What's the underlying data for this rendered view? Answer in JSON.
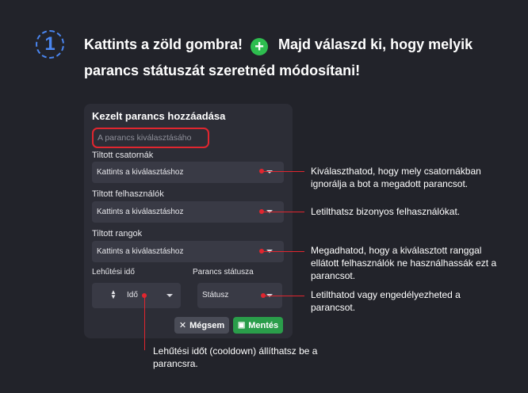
{
  "step": {
    "number": "1"
  },
  "heading": {
    "part1": "Kattints a zöld gombra!",
    "plus_icon": "+",
    "part2": "Majd válaszd ki, hogy melyik parancs státuszát szeretnéd módosítani!"
  },
  "panel": {
    "title": "Kezelt parancs hozzáadása",
    "search_placeholder": "A parancs kiválasztásáho",
    "channels": {
      "label": "Tiltott csatornák",
      "value": "Kattints a kiválasztáshoz"
    },
    "users": {
      "label": "Tiltott felhasználók",
      "value": "Kattints a kiválasztáshoz"
    },
    "roles": {
      "label": "Tiltott rangok",
      "value": "Kattints a kiválasztáshoz"
    },
    "cooldown": {
      "label": "Lehűtési idő",
      "unit": "Idő"
    },
    "status": {
      "label": "Parancs státusza",
      "value": "Státusz"
    },
    "cancel_button": "Mégsem",
    "save_button": "Mentés"
  },
  "annotations": {
    "channels": "Kiválaszthatod, hogy mely csatornákban ignorálja a bot a megadott parancsot.",
    "users": "Letilthatsz bizonyos felhasználókat.",
    "roles": "Megadhatod, hogy a kiválasztott ranggal ellátott felhasználók ne használhassák ezt a parancsot.",
    "status": "Letilthatod vagy engedélyezheted a parancsot.",
    "cooldown": "Lehűtési időt (cooldown) állíthatsz be a parancsra."
  },
  "colors": {
    "accent_green": "#2ebd4f",
    "annotation_red": "#e1262f",
    "step_blue": "#4a86f0"
  }
}
